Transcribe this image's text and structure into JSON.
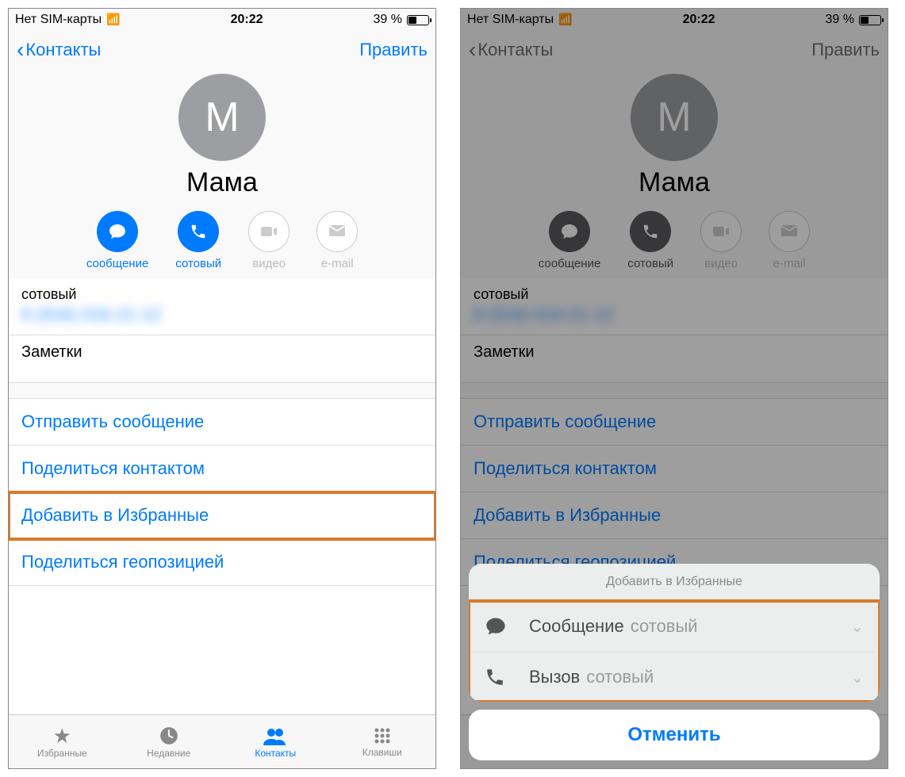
{
  "status": {
    "carrier": "Нет SIM-карты",
    "time": "20:22",
    "battery_pct": "39 %"
  },
  "nav": {
    "back": "Контакты",
    "edit": "Править"
  },
  "contact": {
    "initial": "М",
    "name": "Мама"
  },
  "actions": {
    "message": "сообщение",
    "call": "сотовый",
    "video": "видео",
    "email": "e-mail"
  },
  "fields": {
    "phone_label": "сотовый",
    "phone_value": "8 (916) 016-21-12",
    "notes_label": "Заметки"
  },
  "links": {
    "send_message": "Отправить сообщение",
    "share_contact": "Поделиться контактом",
    "add_favorite": "Добавить в Избранные",
    "share_location": "Поделиться геопозицией"
  },
  "tabs": {
    "favorites": "Избранные",
    "recents": "Недавние",
    "contacts": "Контакты",
    "keypad": "Клавиши"
  },
  "sheet": {
    "title": "Добавить в Избранные",
    "row1_label": "Сообщение",
    "row1_sub": "сотовый",
    "row2_label": "Вызов",
    "row2_sub": "сотовый",
    "cancel": "Отменить"
  }
}
